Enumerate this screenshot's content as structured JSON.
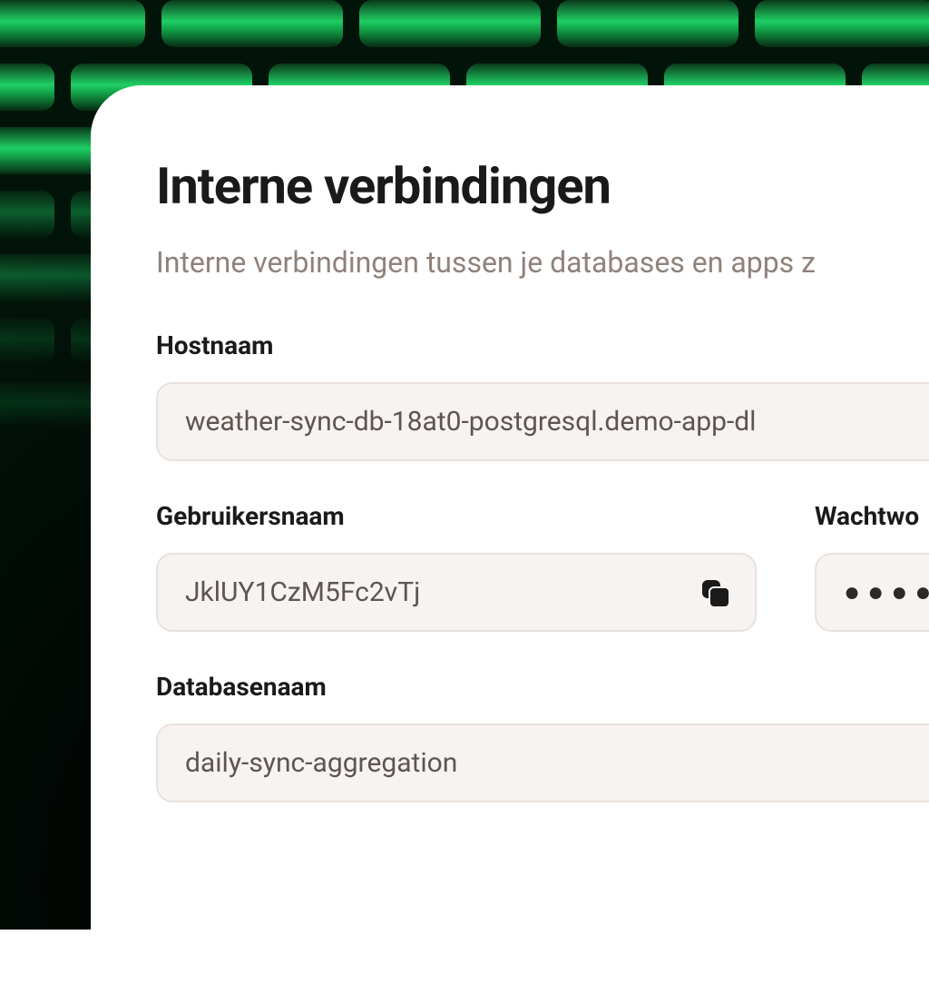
{
  "panel": {
    "title": "Interne verbindingen",
    "subtitle": "Interne verbindingen tussen je databases en apps z"
  },
  "fields": {
    "hostname": {
      "label": "Hostnaam",
      "value": "weather-sync-db-18at0-postgresql.demo-app-dl"
    },
    "username": {
      "label": "Gebruikersnaam",
      "value": "JklUY1CzM5Fc2vTj"
    },
    "password": {
      "label": "Wachtwo",
      "value": "●●●●●●"
    },
    "database": {
      "label": "Databasenaam",
      "value": "daily-sync-aggregation"
    }
  }
}
